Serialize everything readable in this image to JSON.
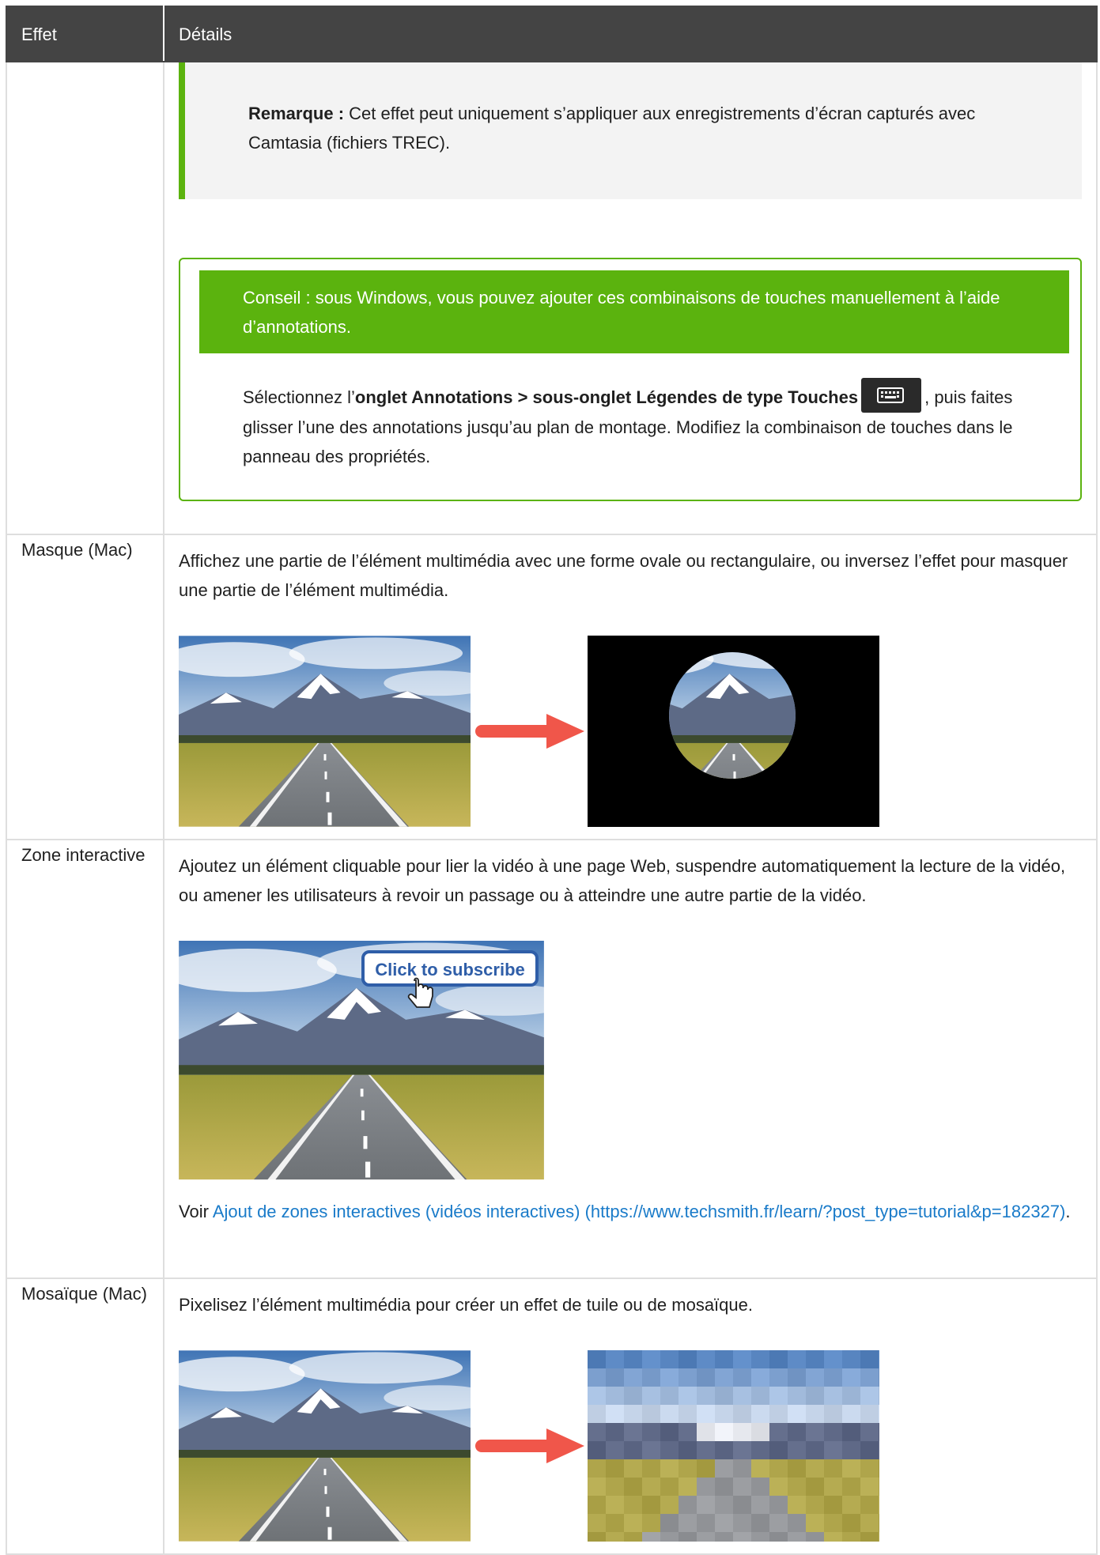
{
  "table": {
    "header": {
      "effect": "Effet",
      "details": "Détails"
    },
    "rows": [
      {
        "effect": "",
        "remarque_label": "Remarque :",
        "remarque_text": " Cet effet peut uniquement s’appliquer aux enregistrements d’écran capturés avec Camtasia (fichiers TREC).",
        "conseil_title": "Conseil : sous Windows, vous pouvez ajouter ces combinaisons de touches manuellement à l’aide d’annotations.",
        "conseil_pre": "Sélectionnez l’",
        "conseil_bold": "onglet Annotations > sous-onglet Légendes de type Touches",
        "conseil_post": ", puis faites glisser l’une des annotations jusqu’au plan de montage. Modifiez la combinaison de touches dans le panneau des propriétés.",
        "conseil_icon": "keyboard-icon"
      },
      {
        "effect": "Masque (Mac)",
        "text": "Affichez une partie de l’élément multimédia avec une forme ovale ou rectangulaire, ou inversez l’effet pour masquer une partie de l’élément multimédia."
      },
      {
        "effect": "Zone interactive",
        "text": "Ajoutez un élément cliquable pour lier la vidéo à une page Web, suspendre automatiquement la lecture de la vidéo, ou amener les utilisateurs à revoir un passage ou à atteindre une autre partie de la vidéo.",
        "callout": "Click to subscribe",
        "see_prefix": "Voir ",
        "see_link": "Ajout de zones interactives (vidéos interactives) (https://www.techsmith.fr/learn/?post_type=tutorial&p=182327)",
        "see_suffix": "."
      },
      {
        "effect": "Mosaïque (Mac)",
        "text": "Pixelisez l’élément multimédia pour créer un effet de tuile ou de mosaïque."
      }
    ]
  },
  "colors": {
    "header_bg": "#444444",
    "accent_green": "#5bb30e",
    "link": "#1a7bc9",
    "arrow": "#f0564a"
  }
}
